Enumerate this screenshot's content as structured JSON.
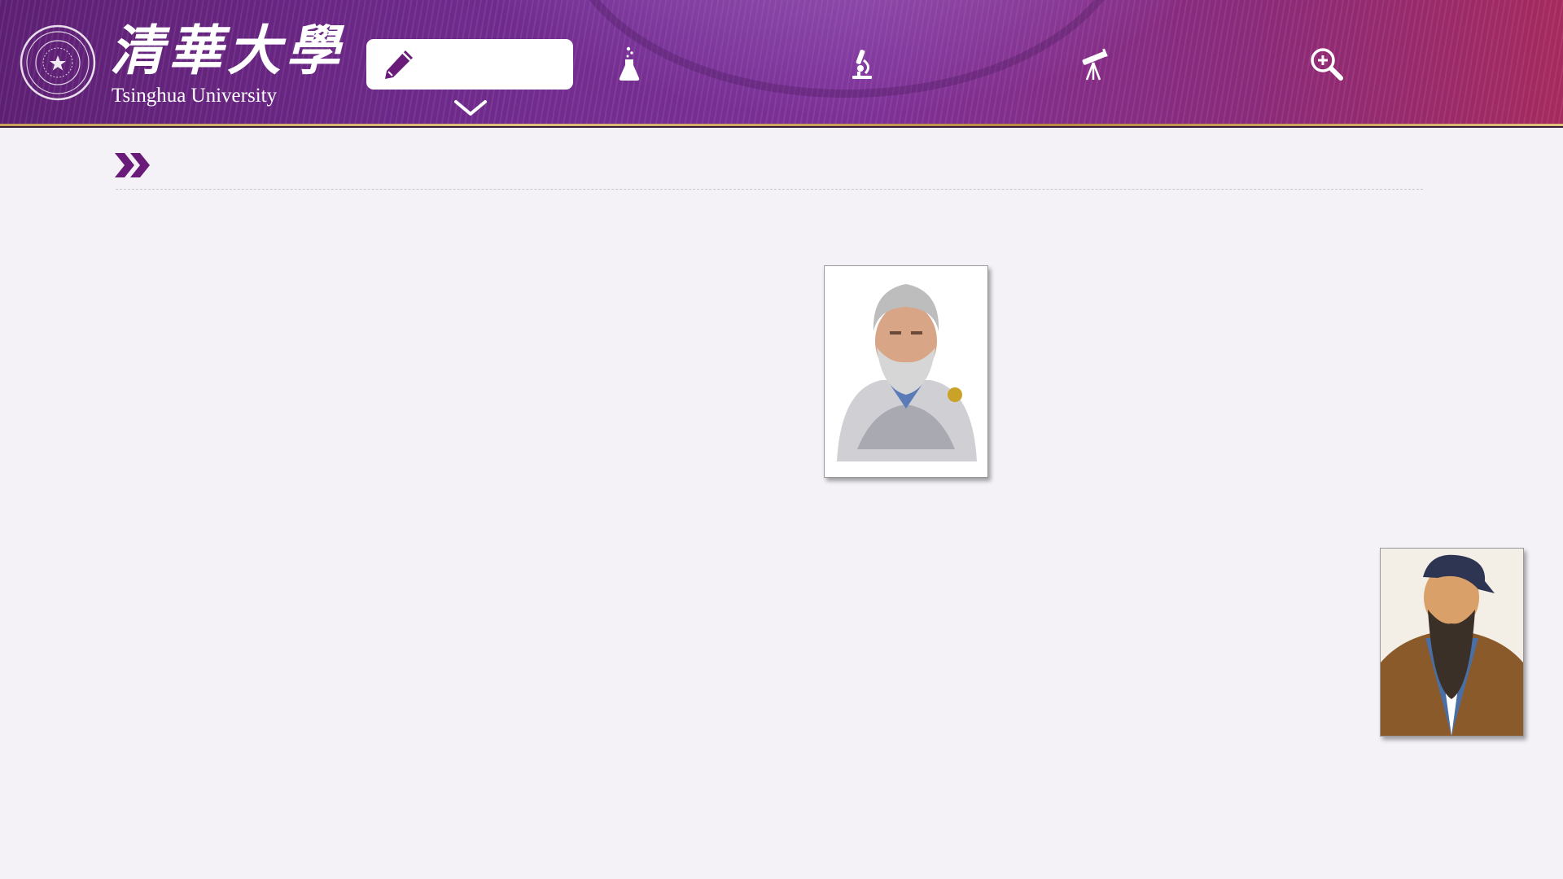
{
  "header": {
    "brand_cn": "清華大學",
    "brand_en": "Tsinghua University",
    "nav": [
      {
        "icon": "pencil-icon",
        "label": "",
        "active": true
      },
      {
        "icon": "flask-icon",
        "label": ""
      },
      {
        "icon": "microscope-icon",
        "label": ""
      },
      {
        "icon": "telescope-icon",
        "label": ""
      },
      {
        "icon": "zoom-in-icon",
        "label": ""
      }
    ],
    "dropdown_icon": "chevron-down-icon"
  },
  "section": {
    "icon": "double-chevron-icon",
    "title": ""
  },
  "portraits": [
    {
      "name": "bearded-philosopher-portrait"
    },
    {
      "name": "confucius-portrait"
    }
  ],
  "colors": {
    "brand_purple": "#6f2a8c",
    "accent_purple": "#6a1b7a",
    "gold": "#c8a35a",
    "background": "#f4f2f7"
  }
}
